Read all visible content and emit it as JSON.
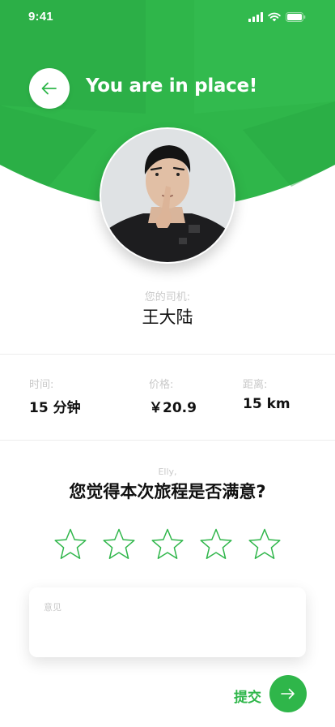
{
  "status_bar": {
    "time": "9:41"
  },
  "header": {
    "title": "You are in place!",
    "back_icon": "arrow-left-icon"
  },
  "driver": {
    "label": "您的司机:",
    "name": "王大陆"
  },
  "trip": {
    "time": {
      "label": "时间:",
      "value": "15 分钟"
    },
    "price": {
      "label": "价格:",
      "value": "￥20.9"
    },
    "distance": {
      "label": "距离:",
      "value": "15 km"
    }
  },
  "rating": {
    "greeting": "Elly,",
    "question": "您觉得本次旅程是否满意?",
    "max_stars": 5,
    "selected_stars": 0
  },
  "feedback": {
    "placeholder": "意见",
    "value": ""
  },
  "submit": {
    "label": "提交",
    "icon": "arrow-right-icon"
  },
  "colors": {
    "accent": "#2fb64a",
    "accent_dark": "#2aaa45",
    "muted_text": "#c9c9c9",
    "text": "#111111"
  }
}
